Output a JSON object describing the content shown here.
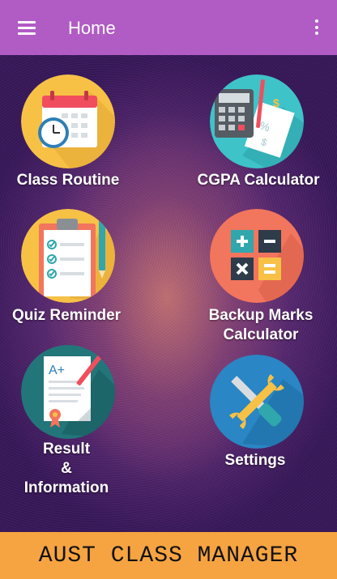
{
  "appbar": {
    "title": "Home",
    "menu_icon": "hamburger-menu-icon",
    "overflow_icon": "more-vert-icon",
    "color": "#b15bc4"
  },
  "tiles": [
    {
      "label": "Class Routine",
      "icon": "calendar-clock-icon",
      "circle_color": "#f7c146"
    },
    {
      "label": "CGPA Calculator",
      "icon": "calculator-document-icon",
      "circle_color": "#3ec3c9"
    },
    {
      "label": "Quiz Reminder",
      "icon": "clipboard-checklist-icon",
      "circle_color": "#f7c146"
    },
    {
      "label_lines": [
        "Backup Marks",
        "Calculator"
      ],
      "icon": "math-operators-icon",
      "circle_color": "#f2755d"
    },
    {
      "label_lines": [
        "Result",
        "&",
        "Information"
      ],
      "icon": "certificate-document-icon",
      "circle_color": "#22767a"
    },
    {
      "label": "Settings",
      "icon": "wrench-screwdriver-icon",
      "circle_color": "#2a86c4"
    }
  ],
  "footer": {
    "text": "AUST CLASS MANAGER",
    "color": "#f6a441"
  }
}
